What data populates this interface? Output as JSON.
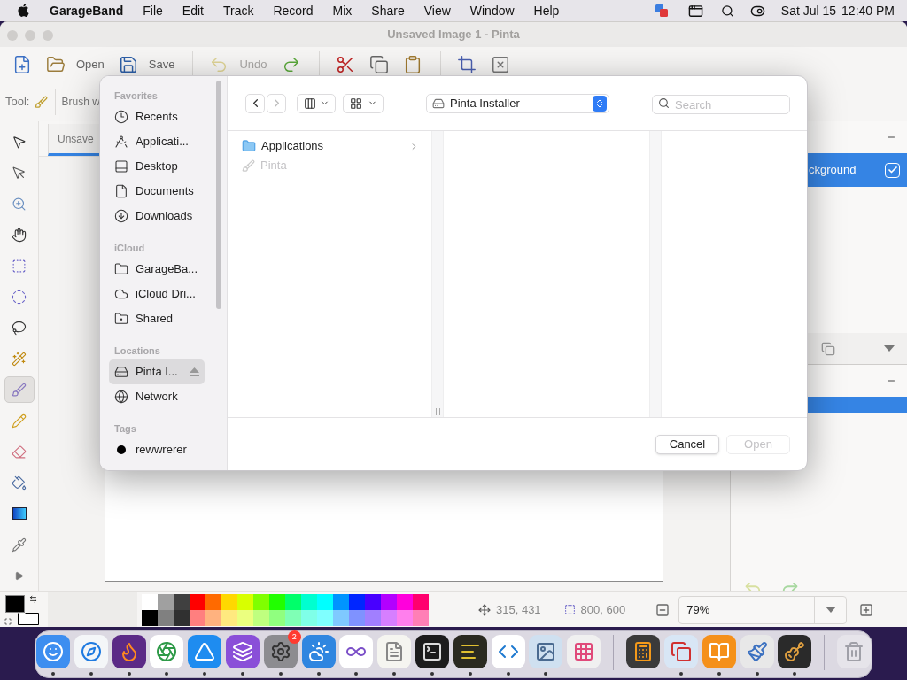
{
  "menu_bar": {
    "app": "GarageBand",
    "menus": [
      "File",
      "Edit",
      "Track",
      "Record",
      "Mix",
      "Share",
      "View",
      "Window",
      "Help"
    ],
    "date": "Sat Jul 15",
    "time": "12:40 PM"
  },
  "window": {
    "title": "Unsaved Image 1 - Pinta"
  },
  "toolbar": [
    [
      {
        "kind": "new",
        "disabled": false
      },
      {
        "kind": "open",
        "label": "Open",
        "disabled": false
      },
      {
        "kind": "save",
        "label": "Save",
        "disabled": false
      }
    ],
    [
      {
        "kind": "undo",
        "label": "Undo",
        "disabled": true
      },
      {
        "kind": "redo",
        "disabled": false
      }
    ],
    [
      {
        "kind": "cut",
        "disabled": false
      },
      {
        "kind": "copy",
        "disabled": false
      },
      {
        "kind": "paste",
        "disabled": false
      }
    ],
    [
      {
        "kind": "crop",
        "disabled": false
      },
      {
        "kind": "deselect",
        "disabled": false
      }
    ]
  ],
  "tool_options": {
    "label": "Tool:",
    "width_label": "Brush w"
  },
  "tools": [
    {
      "kind": "move-selected",
      "selected": false
    },
    {
      "kind": "move-selection",
      "selected": false
    },
    {
      "kind": "zoom",
      "selected": false
    },
    {
      "kind": "pan",
      "selected": false
    },
    {
      "kind": "rect-select",
      "selected": false
    },
    {
      "kind": "ellipse-select",
      "selected": false
    },
    {
      "kind": "lasso",
      "selected": false
    },
    {
      "kind": "magic-wand",
      "selected": false
    },
    {
      "kind": "paintbrush",
      "selected": true
    },
    {
      "kind": "pencil",
      "selected": false
    },
    {
      "kind": "eraser",
      "selected": false
    },
    {
      "kind": "bucket",
      "selected": false
    },
    {
      "kind": "gradient",
      "selected": false
    },
    {
      "kind": "picker",
      "selected": false
    },
    {
      "kind": "more",
      "selected": false
    }
  ],
  "document_tab": {
    "label": "Unsave",
    "selected": true
  },
  "layers": [
    {
      "name": "ckground",
      "selected": true,
      "visible": true
    }
  ],
  "history": [
    {
      "selected": true
    }
  ],
  "palette": {
    "primary": {
      "color": "#000000"
    },
    "secondary": {
      "color": "#ffffff"
    },
    "top": [
      {
        "color": "#ffffff"
      },
      {
        "color": "#a0a0a0"
      },
      {
        "color": "#404040"
      },
      {
        "color": "#ff0000"
      },
      {
        "color": "#ff6a00"
      },
      {
        "color": "#ffd800"
      },
      {
        "color": "#d8ff00"
      },
      {
        "color": "#7fff00"
      },
      {
        "color": "#21ff00"
      },
      {
        "color": "#00ff6a"
      },
      {
        "color": "#00ffd0"
      },
      {
        "color": "#00ffff"
      },
      {
        "color": "#0094ff"
      },
      {
        "color": "#0026ff"
      },
      {
        "color": "#4800ff"
      },
      {
        "color": "#b200ff"
      },
      {
        "color": "#ff00dc"
      },
      {
        "color": "#ff006e"
      }
    ],
    "bottom": [
      {
        "color": "#000000"
      },
      {
        "color": "#808080"
      },
      {
        "color": "#303030"
      },
      {
        "color": "#ff7f7f"
      },
      {
        "color": "#ffb27f"
      },
      {
        "color": "#ffe97f"
      },
      {
        "color": "#ebff7f"
      },
      {
        "color": "#bfff7f"
      },
      {
        "color": "#90ff7f"
      },
      {
        "color": "#7fffb5"
      },
      {
        "color": "#7fffe8"
      },
      {
        "color": "#7fffff"
      },
      {
        "color": "#7fc9ff"
      },
      {
        "color": "#7f92ff"
      },
      {
        "color": "#a17fff"
      },
      {
        "color": "#d67fff"
      },
      {
        "color": "#ff7fed"
      },
      {
        "color": "#ff7fb6"
      }
    ]
  },
  "status": {
    "cursor": "315, 431",
    "size": "800, 600",
    "zoom": "79%"
  },
  "dialog": {
    "sidebar": [
      {
        "heading": "Favorites",
        "items": [
          {
            "kind": "recents",
            "label": "Recents",
            "selected": false
          },
          {
            "kind": "applications",
            "label": "Applicati...",
            "selected": false
          },
          {
            "kind": "desktop",
            "label": "Desktop",
            "selected": false
          },
          {
            "kind": "documents",
            "label": "Documents",
            "selected": false
          },
          {
            "kind": "downloads",
            "label": "Downloads",
            "selected": false
          }
        ]
      },
      {
        "heading": "iCloud",
        "items": [
          {
            "kind": "folder",
            "label": "GarageBa...",
            "selected": false
          },
          {
            "kind": "cloud",
            "label": "iCloud Dri...",
            "selected": false
          },
          {
            "kind": "shared",
            "label": "Shared",
            "selected": false
          }
        ]
      },
      {
        "heading": "Locations",
        "items": [
          {
            "kind": "volume",
            "label": "Pinta I...",
            "selected": true
          },
          {
            "kind": "network",
            "label": "Network",
            "selected": false
          }
        ]
      },
      {
        "heading": "Tags",
        "items": [
          {
            "kind": "tag",
            "label": "rewwrerer",
            "color": "#000000",
            "selected": false
          }
        ]
      }
    ],
    "back_enabled": true,
    "forward_enabled": false,
    "location": "Pinta Installer",
    "search": {
      "placeholder": "Search"
    },
    "column": [
      {
        "kind": "folder",
        "label": "Applications",
        "disabled": false,
        "has_children": true
      },
      {
        "kind": "app",
        "label": "Pinta",
        "disabled": true,
        "has_children": false
      }
    ],
    "buttons": [
      {
        "label": "Cancel",
        "disabled": false
      },
      {
        "label": "Open",
        "disabled": true
      }
    ]
  },
  "dock": [
    {
      "kind": "finder",
      "running": true
    },
    {
      "kind": "safari",
      "running": true
    },
    {
      "kind": "firefox",
      "running": true
    },
    {
      "kind": "chrome",
      "running": true
    },
    {
      "kind": "appstore",
      "running": true
    },
    {
      "kind": "configurator",
      "running": true
    },
    {
      "kind": "settings",
      "running": true,
      "badge": "2"
    },
    {
      "kind": "weather",
      "running": true
    },
    {
      "kind": "vs",
      "running": true
    },
    {
      "kind": "textedit",
      "running": true
    },
    {
      "kind": "terminal",
      "running": true
    },
    {
      "kind": "console",
      "running": true
    },
    {
      "kind": "vscode",
      "running": true
    },
    {
      "kind": "preview",
      "running": true
    },
    {
      "kind": "launchpad",
      "running": false
    },
    {
      "kind": "divider"
    },
    {
      "kind": "calculator",
      "running": false
    },
    {
      "kind": "parallels",
      "running": true
    },
    {
      "kind": "books",
      "running": true
    },
    {
      "kind": "paintbrush",
      "running": true
    },
    {
      "kind": "garageband",
      "running": true
    },
    {
      "kind": "divider"
    },
    {
      "kind": "trash",
      "running": false
    }
  ]
}
